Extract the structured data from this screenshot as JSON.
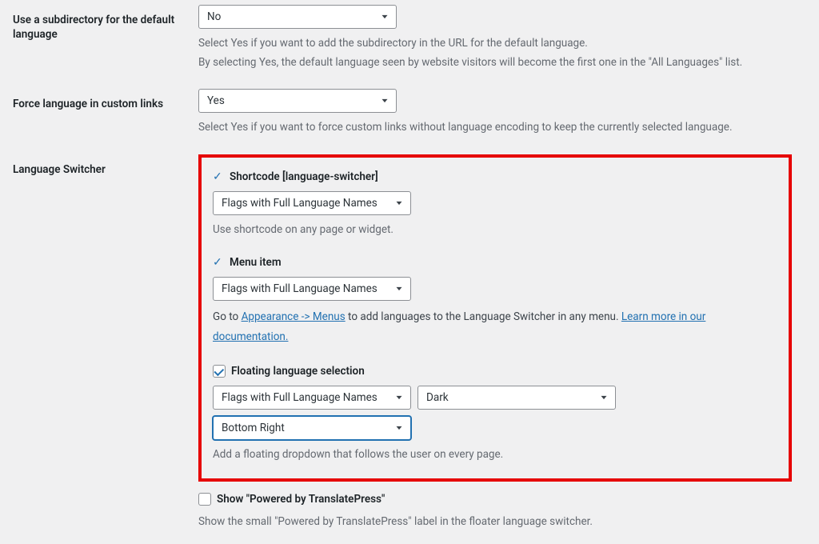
{
  "subdir": {
    "label": "Use a subdirectory for the default language",
    "value": "No",
    "desc1": "Select Yes if you want to add the subdirectory in the URL for the default language.",
    "desc2": "By selecting Yes, the default language seen by website visitors will become the first one in the \"All Languages\" list."
  },
  "force": {
    "label": "Force language in custom links",
    "value": "Yes",
    "desc": "Select Yes if you want to force custom links without language encoding to keep the currently selected language."
  },
  "switcher": {
    "label": "Language Switcher",
    "shortcode": {
      "title": "Shortcode [language-switcher]",
      "value": "Flags with Full Language Names",
      "desc": "Use shortcode on any page or widget."
    },
    "menu": {
      "title": "Menu item",
      "value": "Flags with Full Language Names",
      "desc_prefix": "Go to ",
      "link1": "Appearance -> Menus",
      "desc_mid": " to add languages to the Language Switcher in any menu. ",
      "link2": "Learn more in our documentation."
    },
    "floating": {
      "title": "Floating language selection",
      "style_value": "Flags with Full Language Names",
      "theme_value": "Dark",
      "position_value": "Bottom Right",
      "desc": "Add a floating dropdown that follows the user on every page."
    }
  },
  "powered": {
    "title": "Show \"Powered by TranslatePress\"",
    "desc": "Show the small \"Powered by TranslatePress\" label in the floater language switcher."
  }
}
